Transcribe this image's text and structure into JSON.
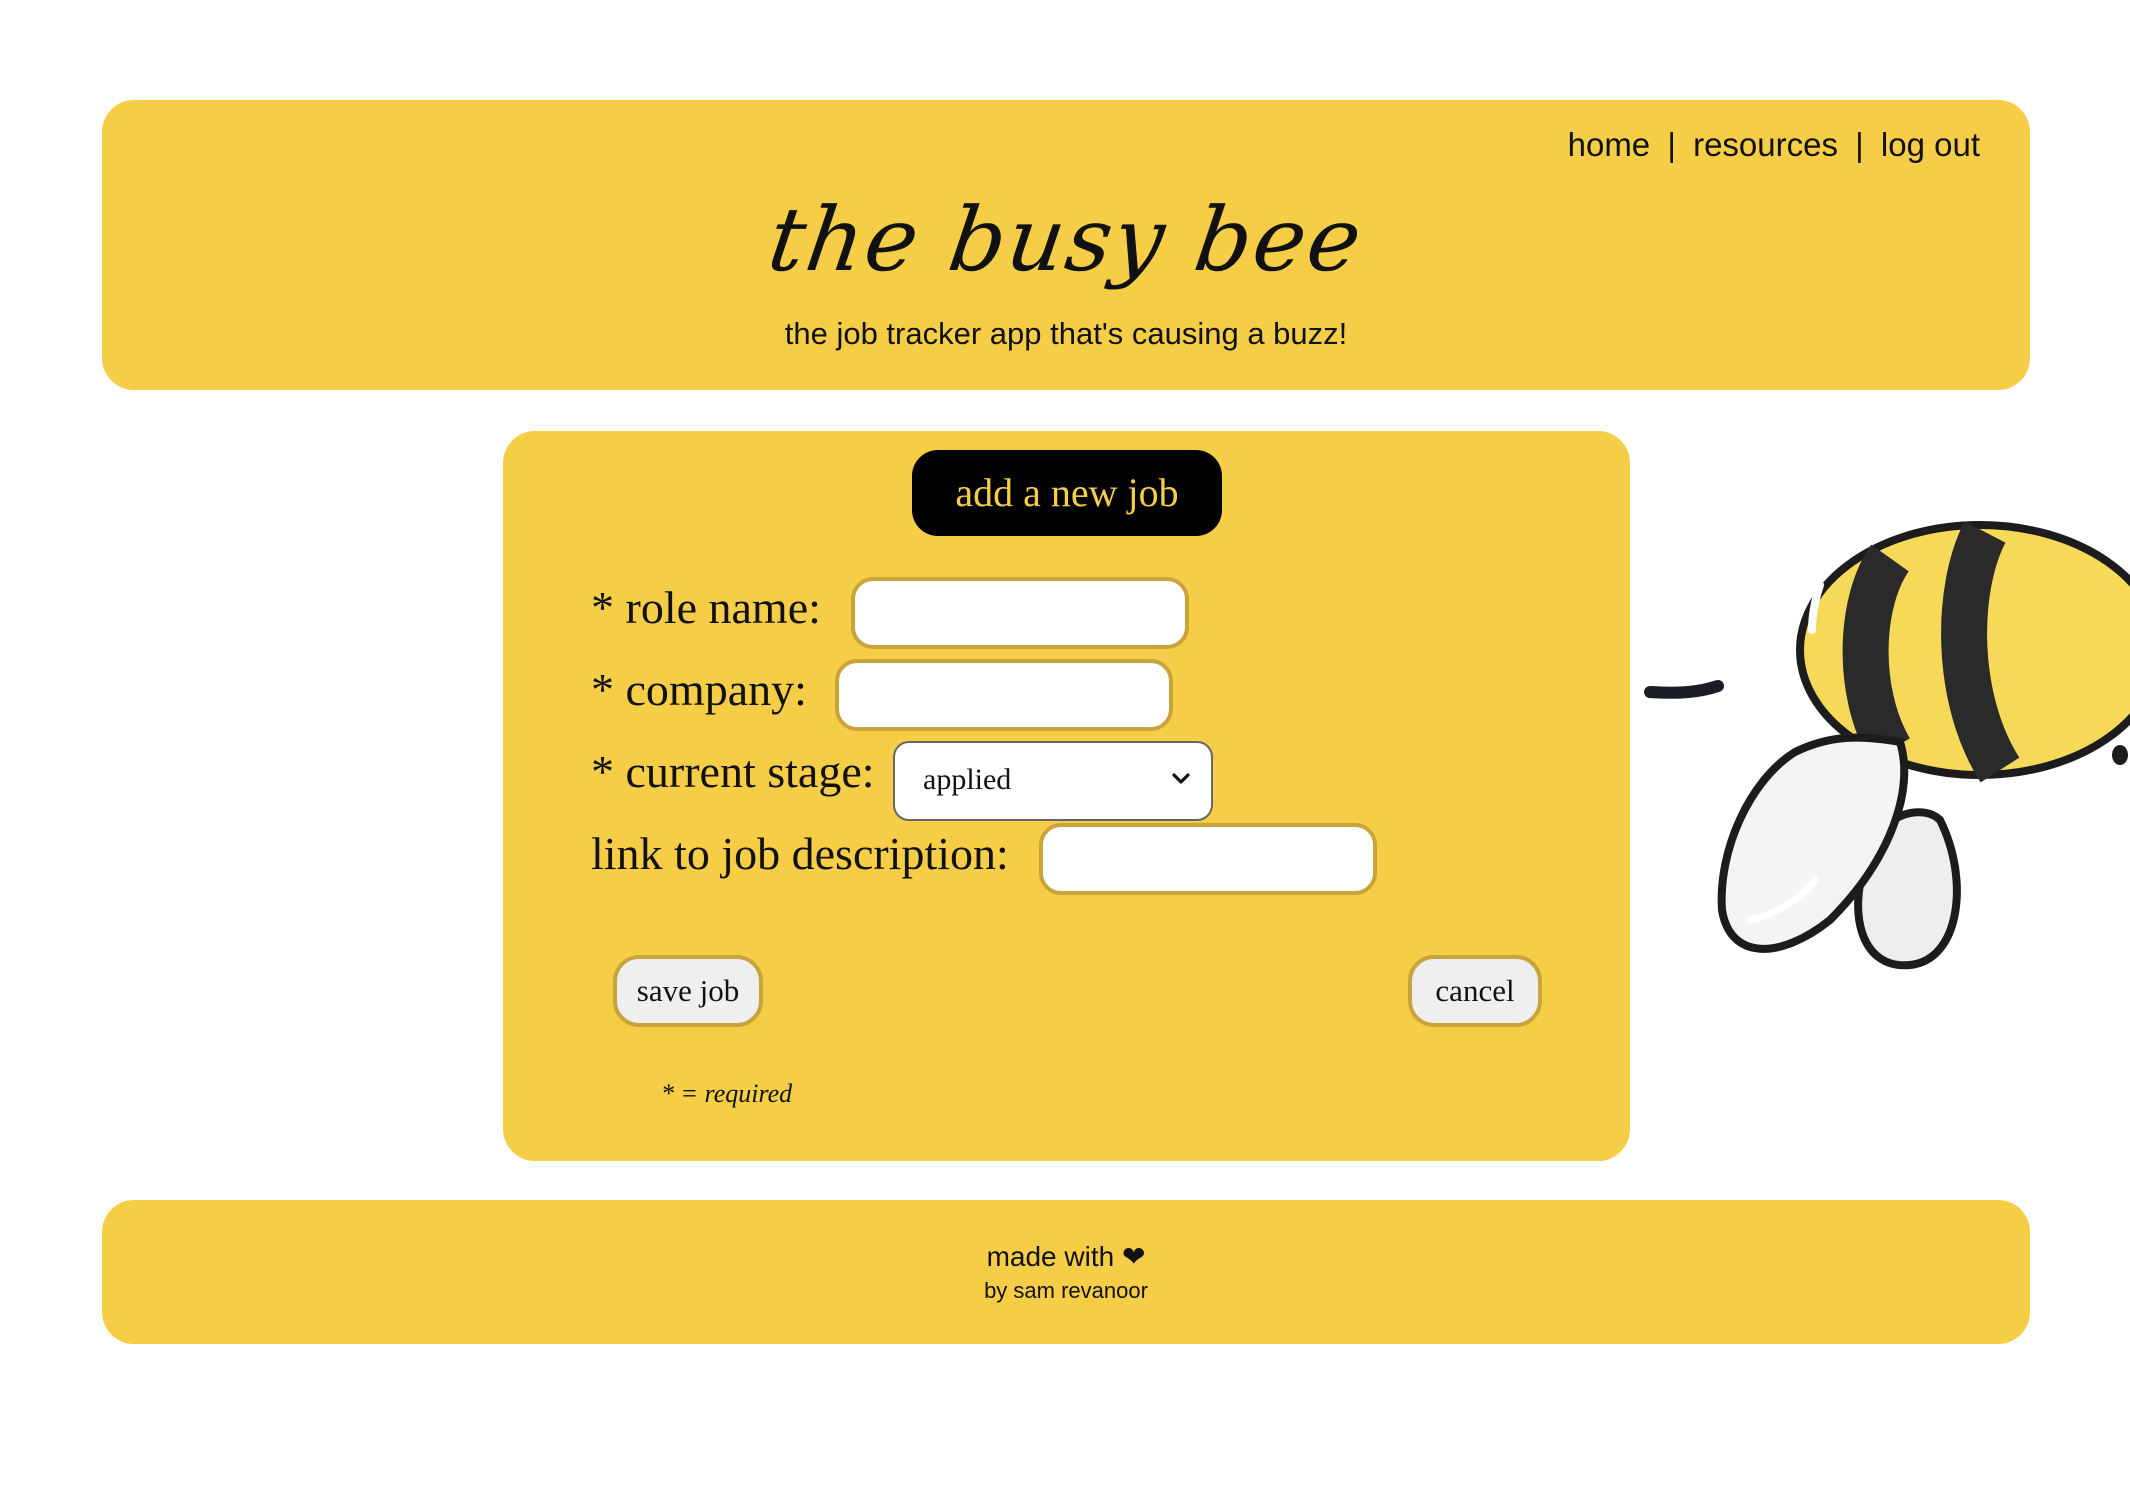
{
  "header": {
    "nav": {
      "home": "home",
      "separator": "|",
      "resources": "resources",
      "logout": "log out"
    },
    "brand": "the busy bee",
    "tagline": "the job tracker app that's causing a buzz!"
  },
  "form": {
    "title": "add a new job",
    "fields": {
      "role_name": {
        "label": "* role name:",
        "value": ""
      },
      "company": {
        "label": "* company:",
        "value": ""
      },
      "current_stage": {
        "label": "* current stage:",
        "selected": "applied"
      },
      "job_link": {
        "label": "link to job description:",
        "value": ""
      }
    },
    "buttons": {
      "save": "save job",
      "cancel": "cancel"
    },
    "required_note": "* = required"
  },
  "footer": {
    "made_with": "made with ❤",
    "byline": "by sam revanoor"
  },
  "colors": {
    "brand_yellow": "#f5cd46",
    "title_bg": "#000000",
    "input_border": "#c9a43d"
  },
  "icons": {
    "select_chevron": "chevron-down-icon",
    "bee": "bee-illustration"
  }
}
